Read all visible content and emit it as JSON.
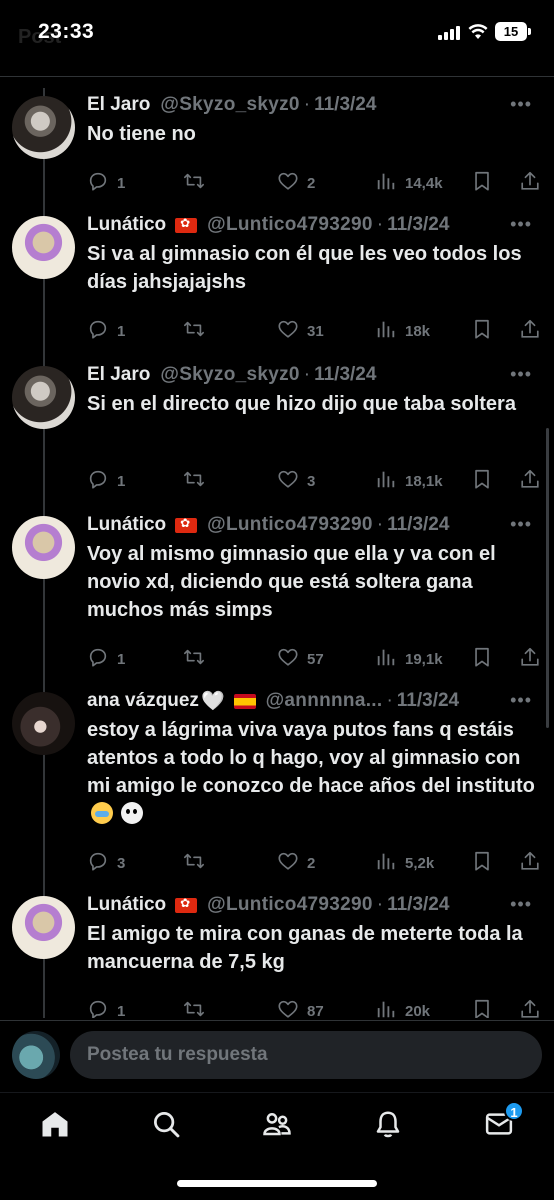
{
  "status_bar": {
    "time": "23:33",
    "battery": "15",
    "faded_title": "Post"
  },
  "thread": {
    "tweets": [
      {
        "name": "El Jaro",
        "flag": "",
        "extra_emoji": "",
        "handle": "@Skyzo_skyz0",
        "date": "11/3/24",
        "text": "No tiene no",
        "replies": "1",
        "retweets": "",
        "likes": "2",
        "views": "14,4k",
        "avatar": "jaro"
      },
      {
        "name": "Lunático",
        "flag": "hk",
        "extra_emoji": "",
        "handle": "@Luntico4793290",
        "date": "11/3/24",
        "text": "Si va al gimnasio con él que les veo todos los días jahsjajajshs",
        "replies": "1",
        "retweets": "",
        "likes": "31",
        "views": "18k",
        "avatar": "luna"
      },
      {
        "name": "El Jaro",
        "flag": "",
        "extra_emoji": "",
        "handle": "@Skyzo_skyz0",
        "date": "11/3/24",
        "text": "Si en el directo que hizo dijo que taba soltera",
        "replies": "1",
        "retweets": "",
        "likes": "3",
        "views": "18,1k",
        "avatar": "jaro"
      },
      {
        "name": "Lunático",
        "flag": "hk",
        "extra_emoji": "",
        "handle": "@Luntico4793290",
        "date": "11/3/24",
        "text": "Voy al mismo gimnasio que ella y va con el novio xd, diciendo que está soltera gana muchos más simps",
        "replies": "1",
        "retweets": "",
        "likes": "57",
        "views": "19,1k",
        "avatar": "luna"
      },
      {
        "name": "ana vázquez",
        "flag": "es",
        "extra_emoji": "🤍",
        "handle": "@annnnna...",
        "date": "11/3/24",
        "text": "estoy a lágrima viva vaya putos fans q estáis atentos a todo lo q hago, voy al gimnasio con mi amigo le conozco de hace años del instituto",
        "replies": "3",
        "retweets": "",
        "likes": "2",
        "views": "5,2k",
        "avatar": "ana"
      },
      {
        "name": "Lunático",
        "flag": "hk",
        "extra_emoji": "",
        "handle": "@Luntico4793290",
        "date": "11/3/24",
        "text": "El amigo te mira con ganas de meterte toda la mancuerna de 7,5 kg",
        "replies": "1",
        "retweets": "",
        "likes": "87",
        "views": "20k",
        "avatar": "luna"
      }
    ]
  },
  "reply_box": {
    "placeholder": "Postea tu respuesta"
  },
  "bottom_nav": {
    "items": [
      "home-icon",
      "search-icon",
      "communities-icon",
      "notifications-icon",
      "messages-icon"
    ],
    "messages_badge": "1"
  },
  "colors": {
    "background": "#000000",
    "muted": "#71767b",
    "accent": "#1d9bf0",
    "text": "#e7e9ea"
  }
}
